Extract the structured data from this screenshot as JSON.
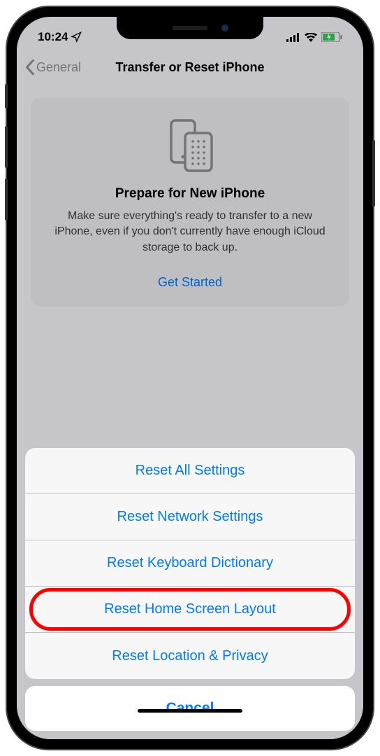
{
  "status": {
    "time": "10:24"
  },
  "nav": {
    "back_label": "General",
    "title": "Transfer or Reset iPhone"
  },
  "prepare": {
    "title": "Prepare for New iPhone",
    "description": "Make sure everything's ready to transfer to a new iPhone, even if you don't currently have enough iCloud storage to back up.",
    "cta": "Get Started"
  },
  "action_sheet": {
    "options": [
      "Reset All Settings",
      "Reset Network Settings",
      "Reset Keyboard Dictionary",
      "Reset Home Screen Layout",
      "Reset Location & Privacy"
    ],
    "highlighted_index": 3,
    "cancel": "Cancel"
  }
}
